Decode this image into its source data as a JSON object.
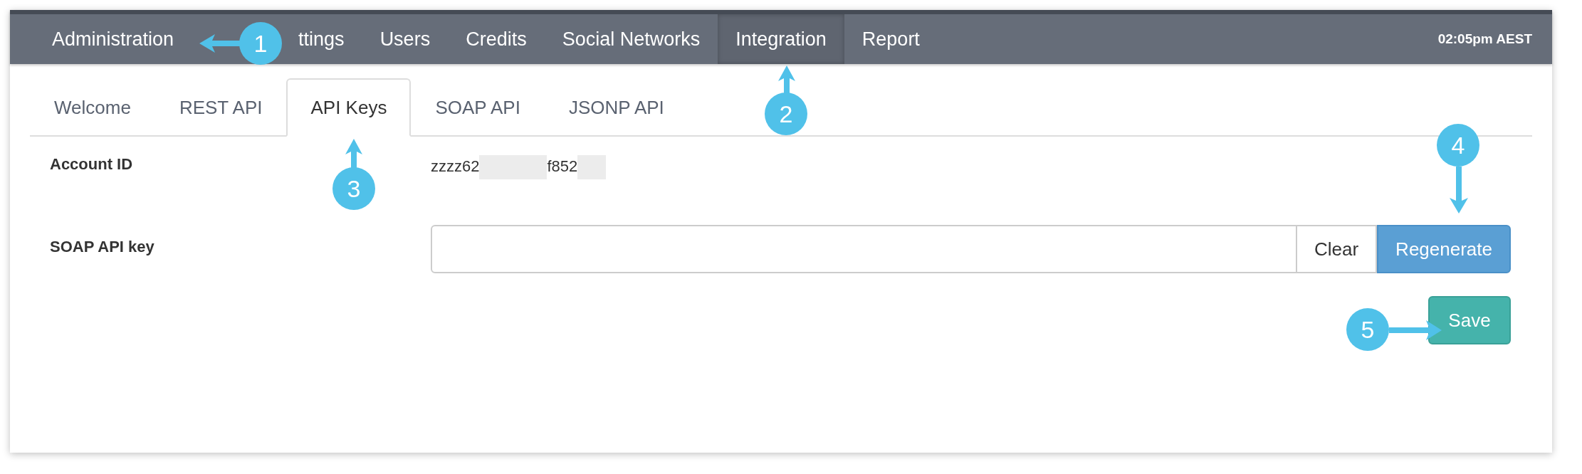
{
  "nav": {
    "items": [
      {
        "label": "Administration",
        "selected": false
      },
      {
        "label": "ttings",
        "selected": false
      },
      {
        "label": "Users",
        "selected": false
      },
      {
        "label": "Credits",
        "selected": false
      },
      {
        "label": "Social Networks",
        "selected": false
      },
      {
        "label": "Integration",
        "selected": true
      },
      {
        "label": "Report",
        "selected": false
      }
    ],
    "time": "02:05pm AEST"
  },
  "tabs": [
    {
      "label": "Welcome",
      "selected": false
    },
    {
      "label": "REST API",
      "selected": false
    },
    {
      "label": "API Keys",
      "selected": true
    },
    {
      "label": "SOAP API",
      "selected": false
    },
    {
      "label": "JSONP API",
      "selected": false
    }
  ],
  "account_id": {
    "label": "Account ID",
    "value_parts": [
      "zzzz62",
      "f852"
    ]
  },
  "soap_api_key": {
    "label": "SOAP API key",
    "buttons": [
      {
        "label": "Clear",
        "kind": "plain"
      },
      {
        "label": "Regenerate",
        "kind": "primary"
      }
    ]
  },
  "save_button": "Save",
  "callouts": [
    {
      "label": "1",
      "kind": "left"
    },
    {
      "label": "2",
      "kind": "up"
    },
    {
      "label": "3",
      "kind": "up"
    },
    {
      "label": "4",
      "kind": "down"
    },
    {
      "label": "5",
      "kind": "right"
    }
  ]
}
